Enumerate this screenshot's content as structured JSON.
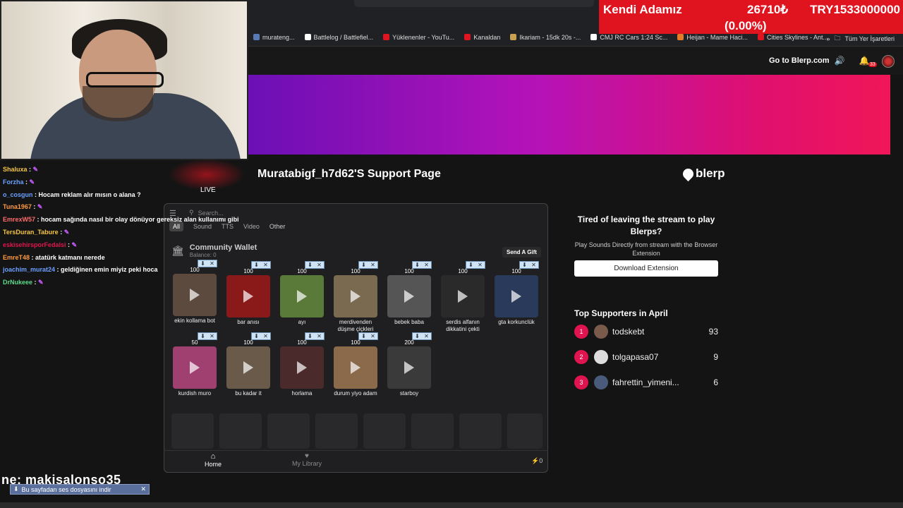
{
  "ticker": {
    "name": "Kendi Adamız",
    "price": "26710₺",
    "change": "(0.00%)",
    "total": "TRY1533000000"
  },
  "bookmarks": [
    {
      "label": "murateng...",
      "color": "#5a7ab5"
    },
    {
      "label": "Battlelog / Battlefiel...",
      "color": "#ffffff"
    },
    {
      "label": "Yüklenenler - YouTu...",
      "color": "#e0141f"
    },
    {
      "label": "Kanaldan",
      "color": "#e0141f"
    },
    {
      "label": "Ikariam - 15dk 20s -...",
      "color": "#c8a050"
    },
    {
      "label": "CMJ RC Cars 1:24 Sc...",
      "color": "#ffffff"
    },
    {
      "label": "Heijan - Mame Haci...",
      "color": "#e57a2a"
    },
    {
      "label": "Cities Skylines - Ant...",
      "color": "#e0141f"
    }
  ],
  "bookmarks_more": "»",
  "all_bookmarks": "Tüm Yer İşaretleri",
  "header": {
    "goto": "Go to Blerp.com",
    "notif_count": "33"
  },
  "support_title": "Muratabigf_h7d62'S Support Page",
  "brand": "blerp",
  "widget": {
    "search_placeholder": "Search...",
    "tabs": [
      "All",
      "Sound",
      "TTS",
      "Video",
      "Other"
    ],
    "wallet_title": "Community Wallet",
    "wallet_balance": "Balance: 0",
    "send_gift": "Send A Gift",
    "home": "Home",
    "library": "My Library",
    "coins": "0"
  },
  "cards": [
    {
      "price": "100",
      "name": "ekin kollama bot",
      "color": "#5c4a3e"
    },
    {
      "price": "100",
      "name": "bar anısı",
      "color": "#8a1a1a"
    },
    {
      "price": "100",
      "name": "ayı",
      "color": "#5a7a3a"
    },
    {
      "price": "100",
      "name": "merdivenden düşme çiçkleri",
      "color": "#7a6a50"
    },
    {
      "price": "100",
      "name": "bebek baba",
      "color": "#555555"
    },
    {
      "price": "100",
      "name": "serdis alfanın dikkatini çekti",
      "color": "#2a2a2a"
    },
    {
      "price": "100",
      "name": "gta korkunclük",
      "color": "#2a3a5a"
    },
    {
      "price": "50",
      "name": "kurdish muro",
      "color": "#a04070"
    },
    {
      "price": "100",
      "name": "bu kadar it",
      "color": "#6a5a4a"
    },
    {
      "price": "100",
      "name": "horlama",
      "color": "#4a2a2a"
    },
    {
      "price": "100",
      "name": "durum yiyo adam",
      "color": "#8a6a4a"
    },
    {
      "price": "200",
      "name": "starboy",
      "color": "#3a3a3a"
    }
  ],
  "promo": {
    "title": "Tired of leaving the stream to play Blerps?",
    "subtitle": "Play Sounds Directly from stream with the Browser Extension",
    "button": "Download Extension"
  },
  "supporters": {
    "title": "Top Supporters in April",
    "list": [
      {
        "rank": "1",
        "name": "todskebt",
        "score": "93",
        "color": "#7a5a4a"
      },
      {
        "rank": "2",
        "name": "tolgapasa07",
        "score": "9",
        "color": "#dddddd"
      },
      {
        "rank": "3",
        "name": "fahrettin_yimeni...",
        "score": "6",
        "color": "#4a5a7a"
      }
    ]
  },
  "live": "LIVE",
  "chat": [
    {
      "user": "Shaluxa",
      "text": "",
      "color": "#f5c542",
      "pen": true
    },
    {
      "user": "Forzha",
      "text": "",
      "color": "#6aa0ff",
      "pen": true
    },
    {
      "user": "o_cosgun",
      "text": "Hocam reklam alır mısın o alana ?",
      "color": "#6aa0ff",
      "pen": false
    },
    {
      "user": "Tuna1967",
      "text": "",
      "color": "#ff9a40",
      "pen": true
    },
    {
      "user": "EmrexW57",
      "text": "hocam sağında nasıl bir olay dönüyor gereksiz alan kullanımı gibi",
      "color": "#ff6b6b",
      "pen": false
    },
    {
      "user": "TersDuran_Tabure",
      "text": "",
      "color": "#f5c542",
      "pen": true
    },
    {
      "user": "eskisehirsporFedalsi",
      "text": "",
      "color": "#e0144f",
      "pen": true
    },
    {
      "user": "EmreT48",
      "text": "atatürk katmanı nerede",
      "color": "#ff9a40",
      "pen": false
    },
    {
      "user": "joachim_murat24",
      "text": "geldiğinen emin miyiz peki hoca",
      "color": "#6aa0ff",
      "pen": false
    },
    {
      "user": "DrNukeee",
      "text": "",
      "color": "#5bd98a",
      "pen": true
    }
  ],
  "overlay_name": "ne: makisalonso35",
  "download_banner": "Bu sayfadan ses dosyasını indir"
}
